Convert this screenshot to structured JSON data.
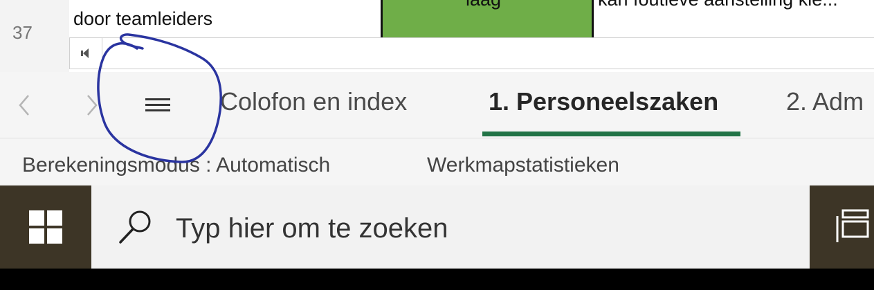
{
  "sheet": {
    "row_number": "37",
    "cells": [
      {
        "text": "door teamleiders"
      },
      {
        "text": "laag"
      },
      {
        "text": "kan foutieve aanstelling kie..."
      }
    ]
  },
  "tabbar": {
    "tabs": [
      {
        "label": "Colofon en index",
        "active": false
      },
      {
        "label": "1. Personeelszaken",
        "active": true
      },
      {
        "label": "2. Adm"
      }
    ],
    "active_tab_color": "#217346"
  },
  "statusbar": {
    "calc_mode": "Berekeningsmodus : Automatisch",
    "workbook_stats": "Werkmapstatistieken"
  },
  "taskbar": {
    "search_placeholder": "Typ hier om te zoeken",
    "background_color": "#3d3526"
  },
  "annotation": {
    "color": "#2a34a0"
  }
}
